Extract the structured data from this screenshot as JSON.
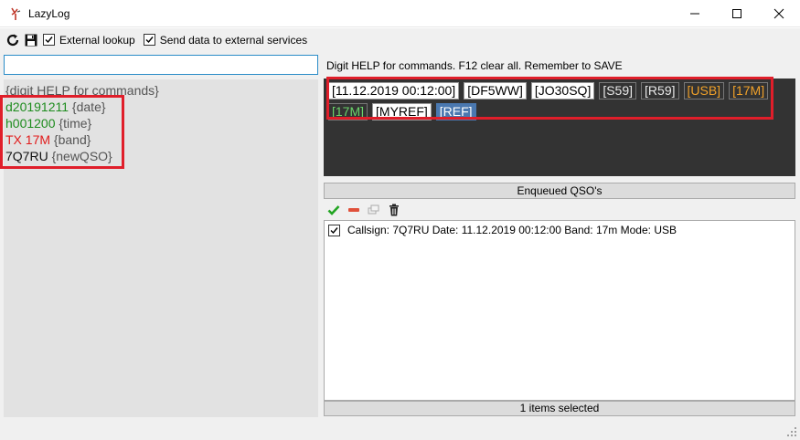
{
  "window": {
    "title": "LazyLog"
  },
  "toolbar": {
    "external_lookup": {
      "label": "External lookup",
      "checked": true
    },
    "send_data": {
      "label": "Send data to external services",
      "checked": true
    }
  },
  "input": {
    "value": ""
  },
  "left_panel": {
    "lines": [
      {
        "parts": [
          {
            "text": "{digit HELP for commands}",
            "color": "gray"
          }
        ]
      },
      {
        "parts": [
          {
            "text": "d20191211",
            "color": "green"
          },
          {
            "text": " {date}",
            "color": "gray"
          }
        ]
      },
      {
        "parts": [
          {
            "text": "h001200",
            "color": "green"
          },
          {
            "text": " {time}",
            "color": "gray"
          }
        ]
      },
      {
        "parts": [
          {
            "text": "TX 17M",
            "color": "red"
          },
          {
            "text": " {band}",
            "color": "gray"
          }
        ]
      },
      {
        "parts": [
          {
            "text": "7Q7RU",
            "color": "black"
          },
          {
            "text": " {newQSO}",
            "color": "gray"
          }
        ]
      }
    ]
  },
  "help_text": "Digit HELP for commands. F12 clear all. Remember to SAVE",
  "tokens": [
    {
      "text": "[11.12.2019 00:12:00]",
      "style": "white"
    },
    {
      "text": "[DF5WW]",
      "style": "white"
    },
    {
      "text": "[JO30SQ]",
      "style": "white"
    },
    {
      "text": "[S59]",
      "style": "plain"
    },
    {
      "text": "[R59]",
      "style": "plain"
    },
    {
      "text": "[USB]",
      "style": "orange"
    },
    {
      "text": "[17M]",
      "style": "orange"
    },
    {
      "text": "[17M]",
      "style": "lgreen"
    },
    {
      "text": "[MYREF]",
      "style": "white"
    },
    {
      "text": "[REF]",
      "style": "blue"
    }
  ],
  "qso": {
    "header": "Enqueued QSO's",
    "items": [
      {
        "label": "Callsign: 7Q7RU Date: 11.12.2019 00:12:00 Band: 17m Mode: USB",
        "checked": true
      }
    ],
    "status": "1 items selected"
  },
  "colors": {
    "highlight": "#e01e2a",
    "green": "#1e8c1e",
    "red": "#e11b1b",
    "orange": "#f0a12a",
    "dark_panel": "#333333"
  }
}
